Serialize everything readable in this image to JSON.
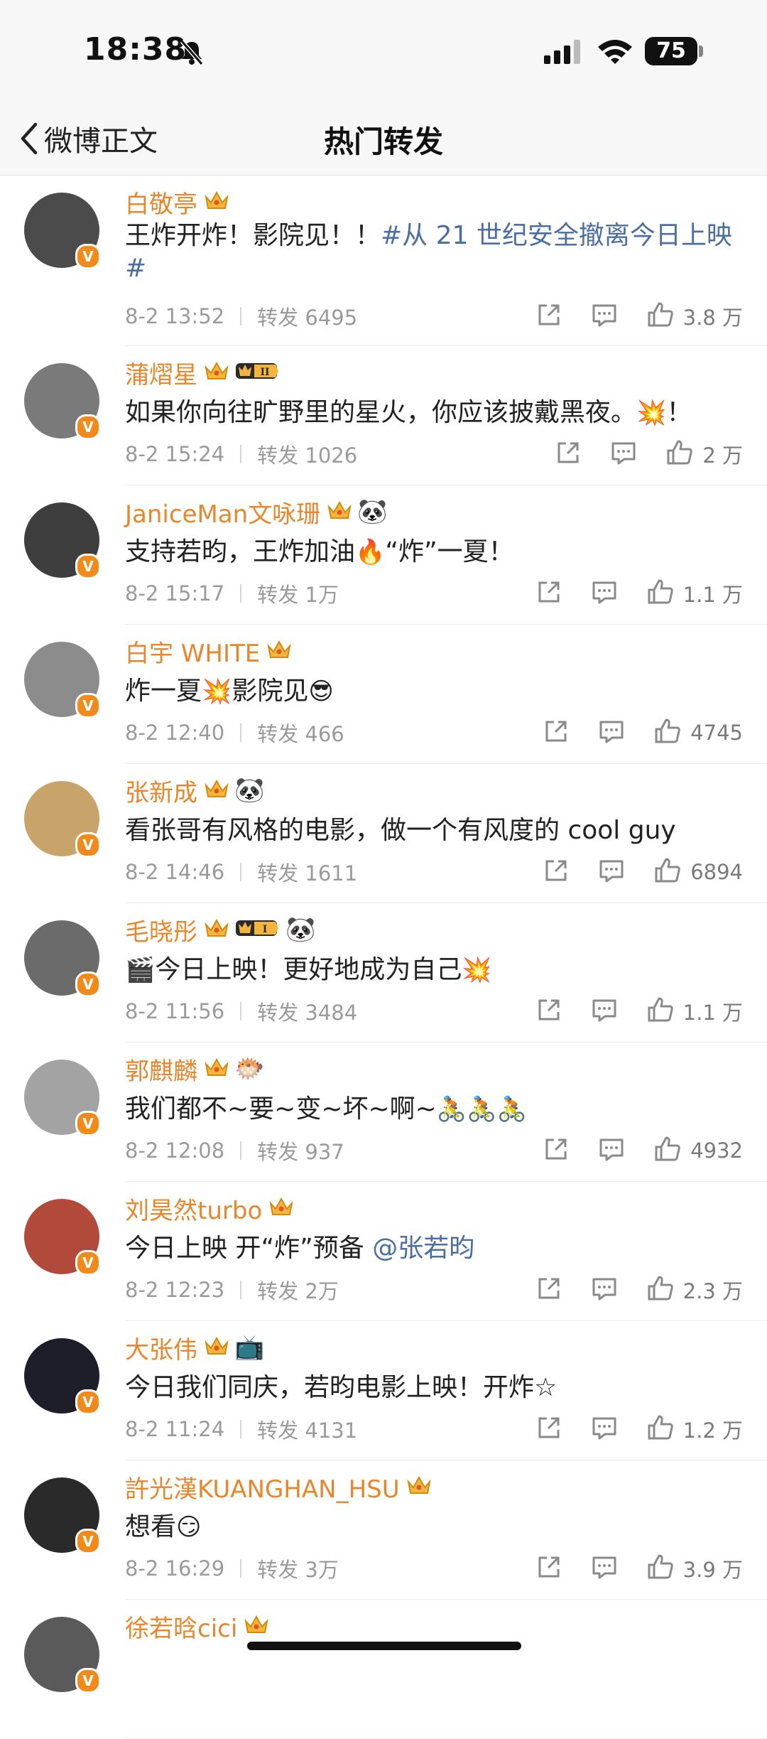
{
  "status": {
    "time": "18:38",
    "battery": "75"
  },
  "nav": {
    "back_label": "微博正文",
    "title": "热门转发"
  },
  "colors": {
    "name": "#e8862b",
    "link": "#4a6fa0",
    "meta": "#9a9a9a",
    "verified": "#f28a1a"
  },
  "items": [
    {
      "name": "白敬亭",
      "content": "王炸开炸！影院见！！",
      "link": "#从 21 世纪安全撤离今日上映#",
      "time": "8-2 13:52",
      "repost": "转发 6495",
      "likes": "3.8 万",
      "avatar_color": "#4b4b4b"
    },
    {
      "name": "蒲熠星",
      "level": "II",
      "content": "如果你向往旷野里的星火，你应该披戴黑夜。",
      "emoji": "💥",
      "suffix": "！",
      "time": "8-2 15:24",
      "repost": "转发 1026",
      "likes": "2 万",
      "avatar_color": "#7a7a7a"
    },
    {
      "name": "JaniceMan文咏珊",
      "panda": "🐼",
      "content": "支持若昀，王炸加油",
      "emoji": "🔥",
      "suffix": "“炸”一夏！",
      "time": "8-2 15:17",
      "repost": "转发 1万",
      "likes": "1.1 万",
      "avatar_color": "#3e3e3e"
    },
    {
      "name": "白宇 WHITE",
      "content": "炸一夏",
      "emoji": "💥",
      "suffix": "影院见",
      "emoji2": "😎",
      "time": "8-2 12:40",
      "repost": "转发 466",
      "likes": "4745",
      "avatar_color": "#8c8c8c"
    },
    {
      "name": "张新成",
      "panda": "🐼",
      "content": "看张哥有风格的电影，做一个有风度的 cool guy",
      "time": "8-2 14:46",
      "repost": "转发 1611",
      "likes": "6894",
      "avatar_color": "#c8a36a"
    },
    {
      "name": "毛晓彤",
      "level": "I",
      "panda": "🐼",
      "prefix_emoji": "🎬",
      "content": "今日上映！更好地成为自己",
      "emoji": "💥",
      "time": "8-2 11:56",
      "repost": "转发 3484",
      "likes": "1.1 万",
      "avatar_color": "#6b6b6b"
    },
    {
      "name": "郭麒麟",
      "panda": "🐡",
      "content": "我们都不~要~变~坏~啊~",
      "emoji": "🚴🚴🚴",
      "time": "8-2 12:08",
      "repost": "转发 937",
      "likes": "4932",
      "avatar_color": "#a3a3a3"
    },
    {
      "name": "刘昊然turbo",
      "content": "今日上映 开“炸”预备 ",
      "link": "@张若昀",
      "time": "8-2 12:23",
      "repost": "转发 2万",
      "likes": "2.3 万",
      "avatar_color": "#b14a3a"
    },
    {
      "name": "大张伟",
      "panda": "📺",
      "content": "今日我们同庆，若昀电影上映！开炸☆",
      "time": "8-2 11:24",
      "repost": "转发 4131",
      "likes": "1.2 万",
      "avatar_color": "#1e1e2a"
    },
    {
      "name": "許光漢KUANGHAN_HSU",
      "content": "想看",
      "emoji": "😏",
      "time": "8-2 16:29",
      "repost": "转发 3万",
      "likes": "3.9 万",
      "avatar_color": "#2a2a2a"
    },
    {
      "name": "徐若晗cici",
      "content": "",
      "time": "",
      "repost": "",
      "likes": "",
      "avatar_color": "#5a5a5a"
    }
  ]
}
